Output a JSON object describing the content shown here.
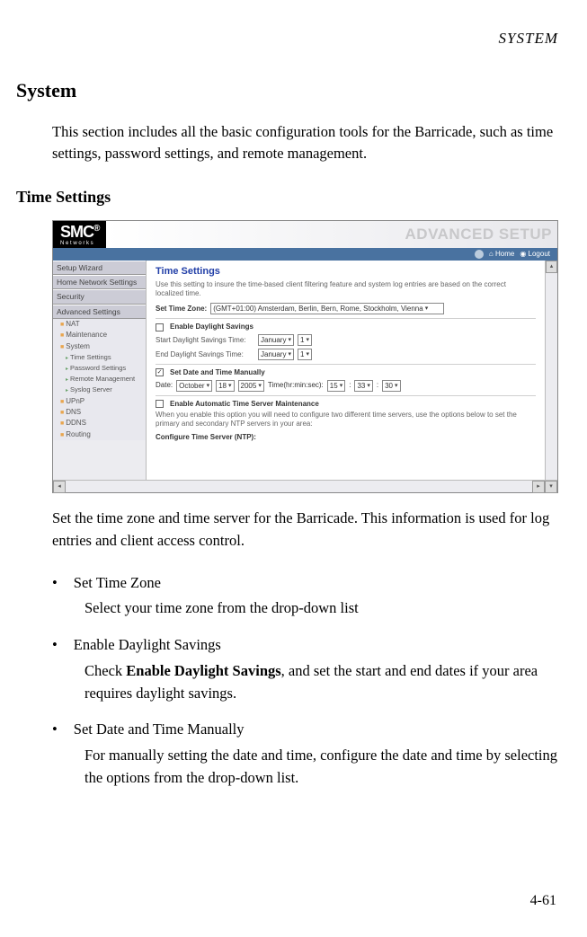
{
  "header": {
    "running_head": "SYSTEM"
  },
  "section": {
    "title": "System",
    "intro": "This section includes all the basic configuration tools for the Barricade, such as time settings, password settings, and remote management."
  },
  "subsection": {
    "title": "Time Settings",
    "caption": "Set the time zone and time server for the Barricade. This information is used for log entries and client access control."
  },
  "screenshot": {
    "logo": "SMC",
    "logo_sub": "N e t w o r k s",
    "banner": "ADVANCED SETUP",
    "topbar": {
      "home": "Home",
      "logout": "Logout"
    },
    "sidebar": {
      "items": [
        {
          "label": "Setup Wizard",
          "type": "h"
        },
        {
          "label": "Home Network Settings",
          "type": "h"
        },
        {
          "label": "Security",
          "type": "h"
        },
        {
          "label": "Advanced Settings",
          "type": "h"
        },
        {
          "label": "NAT",
          "type": "s"
        },
        {
          "label": "Maintenance",
          "type": "s"
        },
        {
          "label": "System",
          "type": "s"
        },
        {
          "label": "Time Settings",
          "type": "s2"
        },
        {
          "label": "Password Settings",
          "type": "s2"
        },
        {
          "label": "Remote Management",
          "type": "s2"
        },
        {
          "label": "Syslog Server",
          "type": "s2"
        },
        {
          "label": "UPnP",
          "type": "s"
        },
        {
          "label": "DNS",
          "type": "s"
        },
        {
          "label": "DDNS",
          "type": "s"
        },
        {
          "label": "Routing",
          "type": "s"
        }
      ]
    },
    "panel": {
      "title": "Time Settings",
      "desc": "Use this setting to insure the time-based client filtering feature and system log entries are based on the correct localized time.",
      "tz_label": "Set Time Zone:",
      "tz_value": "(GMT+01:00) Amsterdam, Berlin, Bern, Rome, Stockholm, Vienna",
      "dst_enable": "Enable Daylight Savings",
      "dst_start_label": "Start Daylight Savings Time:",
      "dst_end_label": "End Daylight Savings Time:",
      "dst_month": "January",
      "dst_day": "1",
      "manual_label": "Set Date and Time Manually",
      "date_label": "Date:",
      "date_month": "October",
      "date_day": "18",
      "date_year": "2005",
      "time_label": "Time(hr:min:sec):",
      "time_h": "15",
      "time_m": "33",
      "time_s": "30",
      "auto_label": "Enable Automatic Time Server Maintenance",
      "auto_desc": "When you enable this option you will need to configure two different time servers, use the options below to set the primary and secondary NTP servers in your area:",
      "ntp_label": "Configure Time Server (NTP):"
    }
  },
  "bullets": [
    {
      "title": "Set Time Zone",
      "desc": "Select your time zone from the drop-down list"
    },
    {
      "title": "Enable Daylight Savings",
      "desc_pre": "Check ",
      "desc_bold": "Enable Daylight Savings",
      "desc_post": ", and set the start and end dates if your area requires daylight savings."
    },
    {
      "title": "Set Date and Time Manually",
      "desc": "For manually setting the date and time, configure the date and time by selecting the options from the drop-down list."
    }
  ],
  "page_number": "4-61"
}
